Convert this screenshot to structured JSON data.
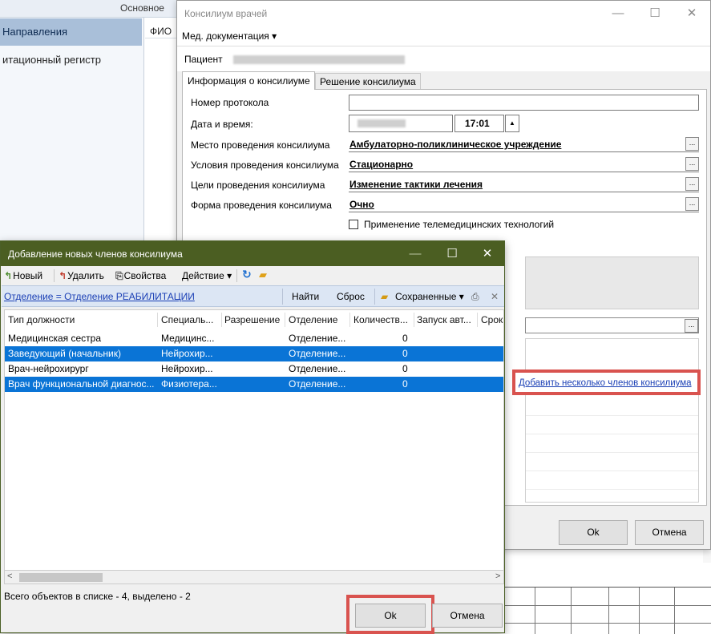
{
  "background_app": {
    "top_tab": "Основное",
    "nav": {
      "directions": "Направления",
      "register": "итационный регистр"
    },
    "list_header": "ФИО"
  },
  "konsilium_window": {
    "title": "Консилиум врачей",
    "controls": {
      "minimize": "—",
      "maximize": "☐",
      "close": "✕"
    },
    "menu": {
      "med_docs": "Мед. документация ▾"
    },
    "patient_label": "Пациент",
    "tabs": {
      "info": "Информация о консилиуме",
      "decision": "Решение консилиума"
    },
    "form": {
      "protocol_label": "Номер протокола",
      "datetime_label": "Дата и время:",
      "time_value": "17:01",
      "place_label": "Место проведения консилиума",
      "place_value": "Амбулаторно-поликлиническое учреждение",
      "conditions_label": "Условия проведения консилиума",
      "conditions_value": "Стационарно",
      "goals_label": "Цели проведения консилиума",
      "goals_value": "Изменение тактики лечения",
      "form_label": "Форма проведения консилиума",
      "form_value": "Очно",
      "telemed_label": "Применение телемедицинских технологий",
      "ellipsis": "..."
    },
    "add_members_link": "Добавить несколько членов консилиума",
    "buttons": {
      "ok": "Ok",
      "cancel": "Отмена"
    }
  },
  "add_members_dialog": {
    "title": "Добавление новых членов консилиума",
    "controls": {
      "minimize": "—",
      "maximize": "☐",
      "close": "✕"
    },
    "toolbar": {
      "new": "Новый",
      "delete": "Удалить",
      "properties": "Свойства",
      "action": "Действие ▾"
    },
    "filter": {
      "condition": "Отделение = Отделение РЕАБИЛИТАЦИИ",
      "find": "Найти",
      "reset": "Сброс",
      "saved": "Сохраненные ▾",
      "close": "✕"
    },
    "columns": [
      "Тип должности",
      "Специаль...",
      "Разрешение",
      "Отделение",
      "Количеств...",
      "Запуск авт...",
      "Срок"
    ],
    "rows": [
      {
        "type": "Медицинская сестра",
        "spec": "Медицинс...",
        "perm": "",
        "dept": "Отделение...",
        "count": "0",
        "selected": false
      },
      {
        "type": "Заведующий (начальник)",
        "spec": "Нейрохир...",
        "perm": "",
        "dept": "Отделение...",
        "count": "0",
        "selected": true
      },
      {
        "type": "Врач-нейрохирург",
        "spec": "Нейрохир...",
        "perm": "",
        "dept": "Отделение...",
        "count": "0",
        "selected": false
      },
      {
        "type": "Врач функциональной диагнос...",
        "spec": "Физиотера...",
        "perm": "",
        "dept": "Отделение...",
        "count": "0",
        "selected": true
      }
    ],
    "scroll": {
      "left": "<",
      "right": ">"
    },
    "status": "Всего объектов в списке - 4, выделено - 2",
    "buttons": {
      "ok": "Ok",
      "cancel": "Отмена"
    }
  }
}
